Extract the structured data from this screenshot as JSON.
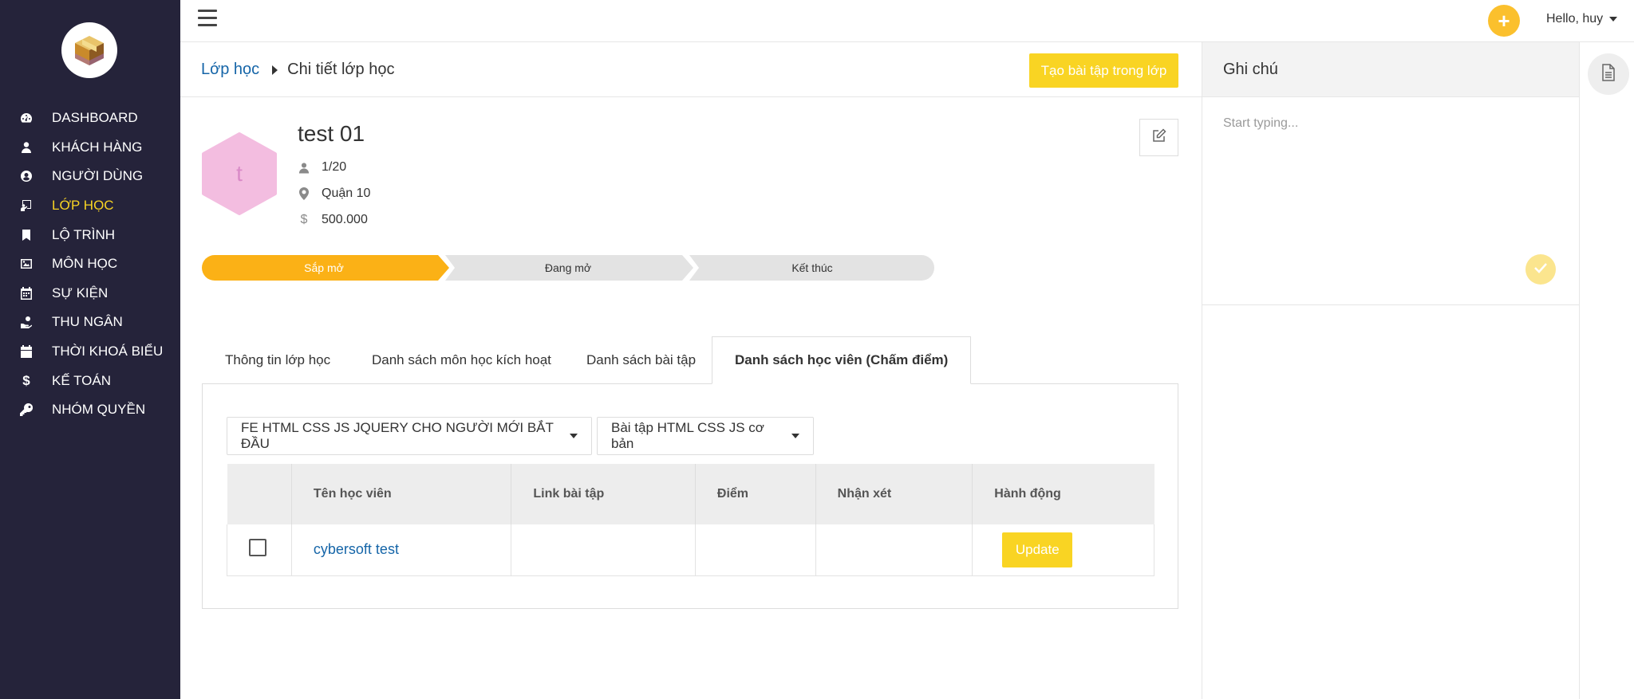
{
  "sidebar": {
    "logo_icon": "box-logo-icon",
    "items": [
      {
        "label": "DASHBOARD",
        "icon": "dashboard-icon"
      },
      {
        "label": "KHÁCH HÀNG",
        "icon": "user-icon"
      },
      {
        "label": "NGƯỜI DÙNG",
        "icon": "user-circle-icon"
      },
      {
        "label": "LỚP HỌC",
        "icon": "chalkboard-icon",
        "active": true
      },
      {
        "label": "LỘ TRÌNH",
        "icon": "bookmark-icon"
      },
      {
        "label": "MÔN HỌC",
        "icon": "image-icon"
      },
      {
        "label": "SỰ KIỆN",
        "icon": "calendar-icon"
      },
      {
        "label": "THU NGÂN",
        "icon": "hand-coin-icon"
      },
      {
        "label": "THỜI KHOÁ BIỂU",
        "icon": "calendar-solid-icon"
      },
      {
        "label": "KẾ TOÁN",
        "icon": "dollar-icon"
      },
      {
        "label": "NHÓM QUYỀN",
        "icon": "key-icon"
      }
    ],
    "active_color": "#f9d423",
    "bg_color": "#25233a"
  },
  "topbar": {
    "plus_label": "+",
    "greeting": "Hello, huy"
  },
  "header": {
    "breadcrumb_parent": "Lớp học",
    "breadcrumb_current": "Chi tiết lớp học",
    "create_button": "Tạo bài tập trong lớp"
  },
  "class_info": {
    "avatar_letter": "t",
    "title": "test 01",
    "students": "1/20",
    "location": "Quận 10",
    "price": "500.000"
  },
  "steps": [
    {
      "label": "Sắp mở",
      "active": true
    },
    {
      "label": "Đang mở",
      "active": false
    },
    {
      "label": "Kết thúc",
      "active": false
    }
  ],
  "tabs": [
    {
      "label": "Thông tin lớp học"
    },
    {
      "label": "Danh sách môn học kích hoạt"
    },
    {
      "label": "Danh sách bài tập"
    },
    {
      "label": "Danh sách học viên (Chấm điểm)",
      "active": true
    }
  ],
  "filters": {
    "course": "FE HTML CSS JS JQUERY CHO NGƯỜI MỚI BẮT ĐẦU",
    "assignment": "Bài tập HTML CSS JS cơ bản"
  },
  "table": {
    "columns": [
      "",
      "Tên học viên",
      "Link bài tập",
      "Điểm",
      "Nhận xét",
      "Hành động"
    ],
    "rows": [
      {
        "name": "cybersoft test",
        "link": "",
        "score": "",
        "comment": "",
        "action": "Update"
      }
    ]
  },
  "notes": {
    "title": "Ghi chú",
    "placeholder": "Start typing..."
  },
  "colors": {
    "accent": "#f9d423",
    "link": "#1565a8",
    "step_active": "#fbb116",
    "step_inactive": "#e3e3e3"
  }
}
